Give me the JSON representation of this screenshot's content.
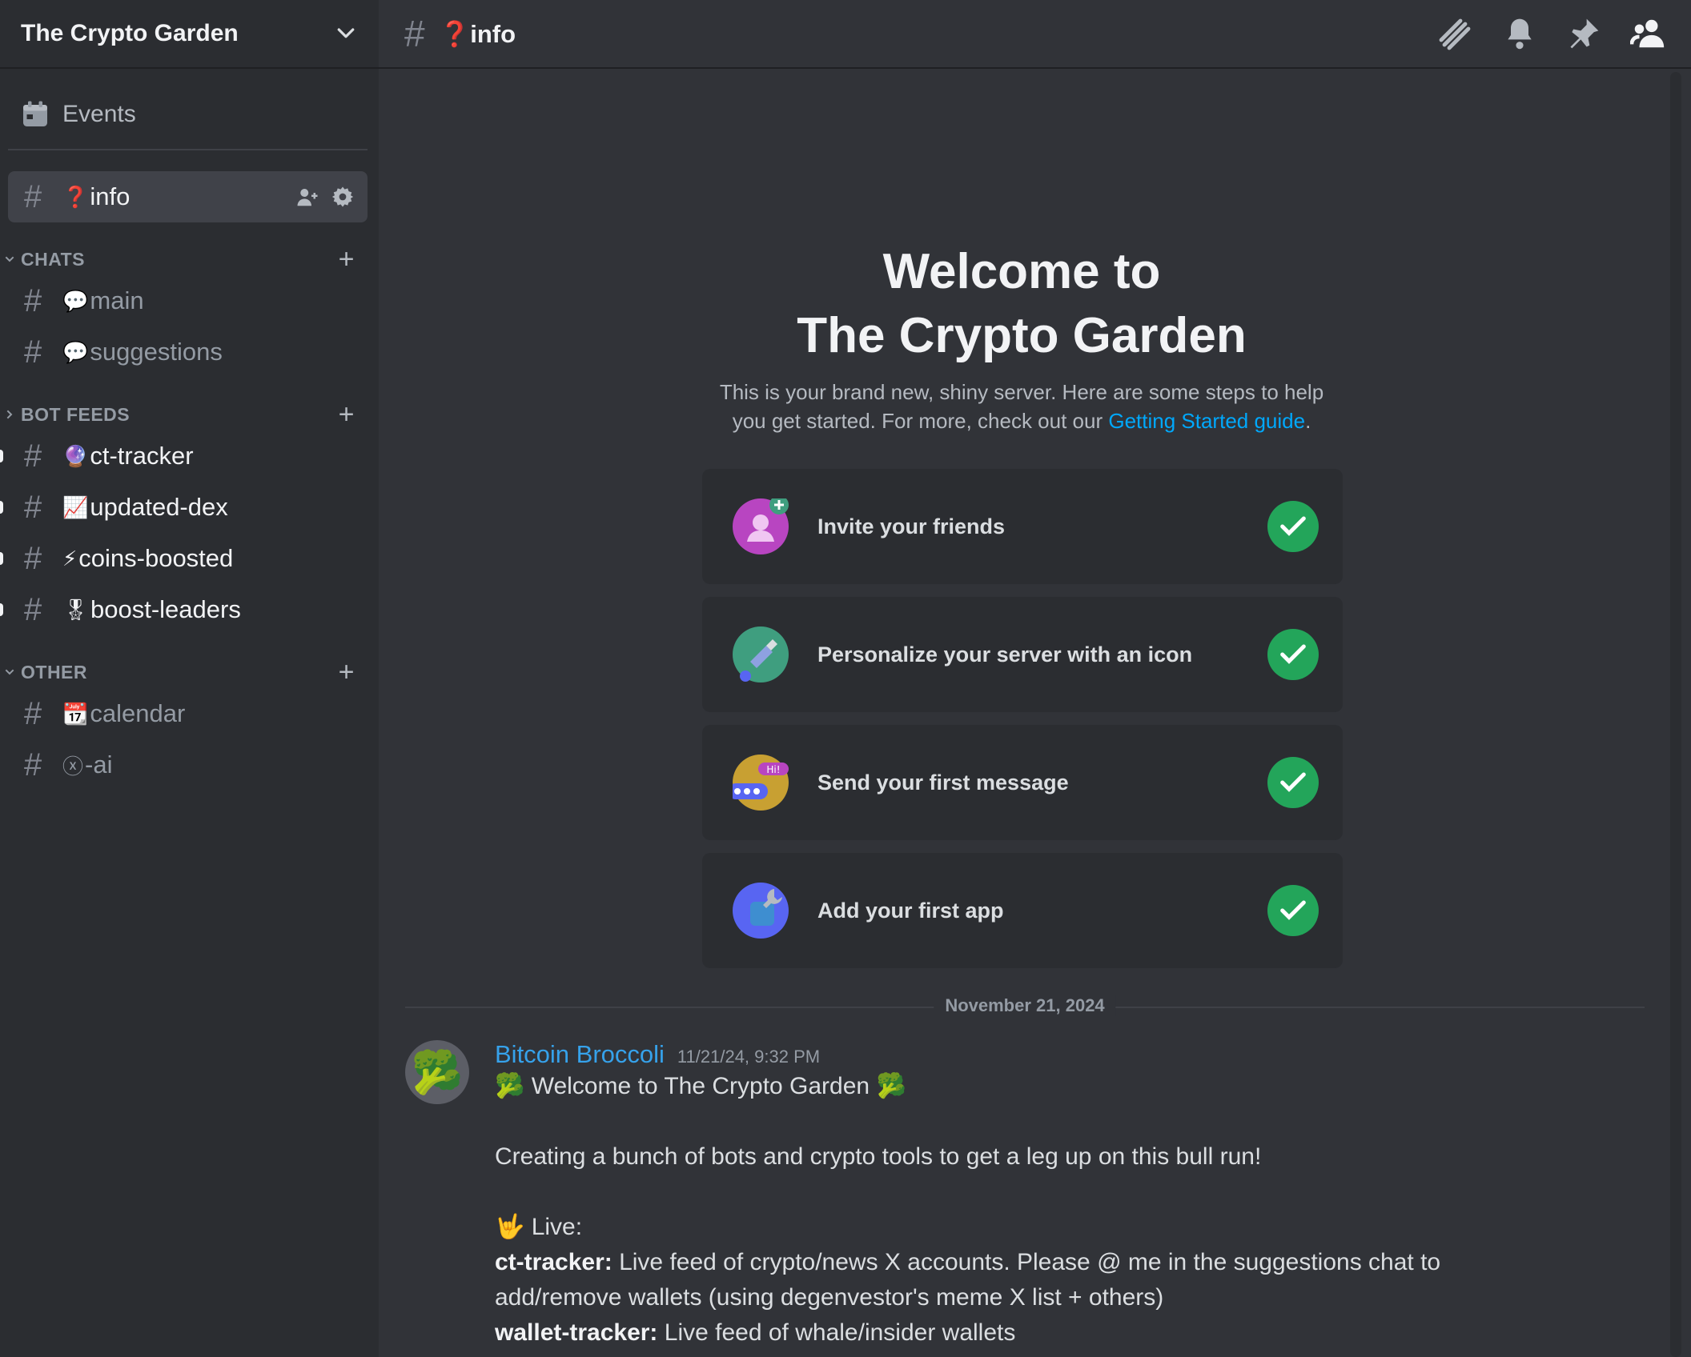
{
  "server": {
    "name": "The Crypto Garden"
  },
  "sidebar": {
    "events_label": "Events",
    "active_channel": {
      "emoji": "❓",
      "name": "info"
    },
    "categories": [
      {
        "name": "CHATS",
        "channels": [
          {
            "emoji": "💬",
            "name": "main"
          },
          {
            "emoji": "💬",
            "name": "suggestions"
          }
        ]
      },
      {
        "name": "BOT FEEDS",
        "channels": [
          {
            "emoji": "🔮",
            "name": "ct-tracker"
          },
          {
            "emoji": "📈",
            "name": "updated-dex"
          },
          {
            "emoji": "⚡",
            "name": "coins-boosted"
          },
          {
            "emoji": "🎖",
            "name": "boost-leaders"
          }
        ]
      },
      {
        "name": "OTHER",
        "channels": [
          {
            "emoji": "📆",
            "name": "calendar"
          },
          {
            "emoji": "ⓧ",
            "name": "-ai"
          }
        ]
      }
    ]
  },
  "topbar": {
    "emoji": "❓",
    "channel": "info"
  },
  "welcome": {
    "title_line1": "Welcome to",
    "title_line2": "The Crypto Garden",
    "desc_line1": "This is your brand new, shiny server. Here are some steps to help",
    "desc_line2_prefix": "you get started. For more, check out our ",
    "desc_link": "Getting Started guide",
    "desc_suffix": "."
  },
  "tasks": [
    {
      "label": "Invite your friends",
      "icon": "invite-friends-icon",
      "color": "#b845c1"
    },
    {
      "label": "Personalize your server with an icon",
      "icon": "paintbrush-icon",
      "color": "#3f9e7f"
    },
    {
      "label": "Send your first message",
      "icon": "message-bubble-icon",
      "color": "#c8a032"
    },
    {
      "label": "Add your first app",
      "icon": "app-wrench-icon",
      "color": "#5865f2"
    }
  ],
  "date_divider": "November 21, 2024",
  "message": {
    "author": "Bitcoin Broccoli",
    "timestamp": "11/21/24, 9:32 PM",
    "avatar_emoji": "🥦",
    "line1": "🥦 Welcome to The Crypto Garden 🥦",
    "line2": "Creating a bunch of bots and crypto tools to get a leg up on this bull run!",
    "line3": "🤟 Live:",
    "line4_bold": "ct-tracker:",
    "line4_rest": " Live feed of crypto/news X accounts. Please @ me in the suggestions chat to",
    "line5": "add/remove wallets (using degenvestor's meme X list + others)",
    "line6_bold": "wallet-tracker:",
    "line6_rest": " Live feed of whale/insider wallets"
  }
}
